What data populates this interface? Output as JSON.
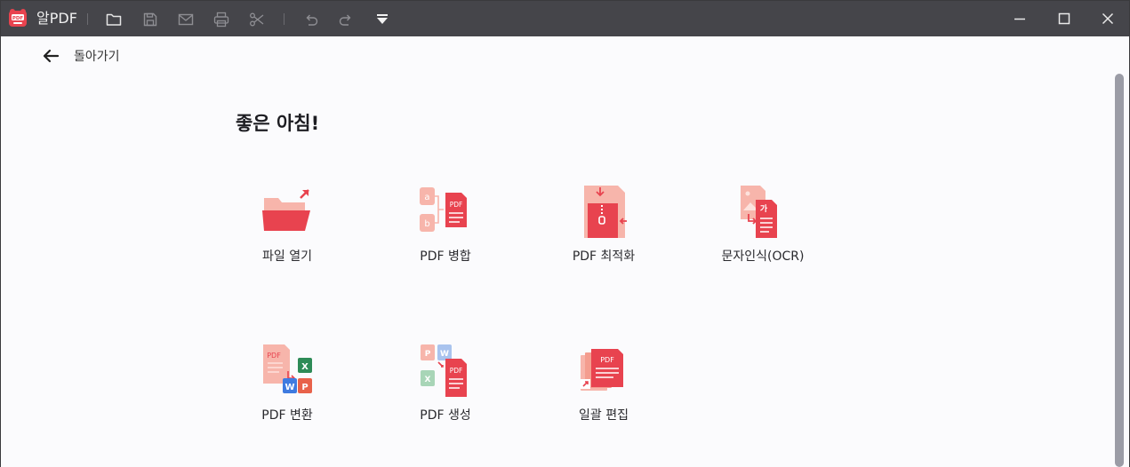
{
  "app": {
    "name": "알PDF"
  },
  "toolbar": {
    "icons": [
      "folder-icon",
      "save-icon",
      "mail-icon",
      "print-icon",
      "scissors-icon",
      "undo-icon",
      "redo-icon",
      "dropdown-icon"
    ]
  },
  "window_controls": [
    "minimize-icon",
    "maximize-icon",
    "close-icon"
  ],
  "nav": {
    "back_label": "돌아가기"
  },
  "greeting": "좋은 아침!",
  "tiles": [
    {
      "label": "파일 열기",
      "icon": "open-file-icon"
    },
    {
      "label": "PDF 병합",
      "icon": "pdf-merge-icon"
    },
    {
      "label": "PDF 최적화",
      "icon": "pdf-optimize-icon"
    },
    {
      "label": "문자인식(OCR)",
      "icon": "ocr-icon"
    },
    {
      "label": "PDF 변환",
      "icon": "pdf-convert-icon"
    },
    {
      "label": "PDF 생성",
      "icon": "pdf-create-icon"
    },
    {
      "label": "일괄 편집",
      "icon": "batch-edit-icon"
    }
  ],
  "colors": {
    "titlebar": "#45454a",
    "accent": "#e8434f",
    "accent_light": "#f7b5ab",
    "content_bg": "#fbfbfd"
  }
}
